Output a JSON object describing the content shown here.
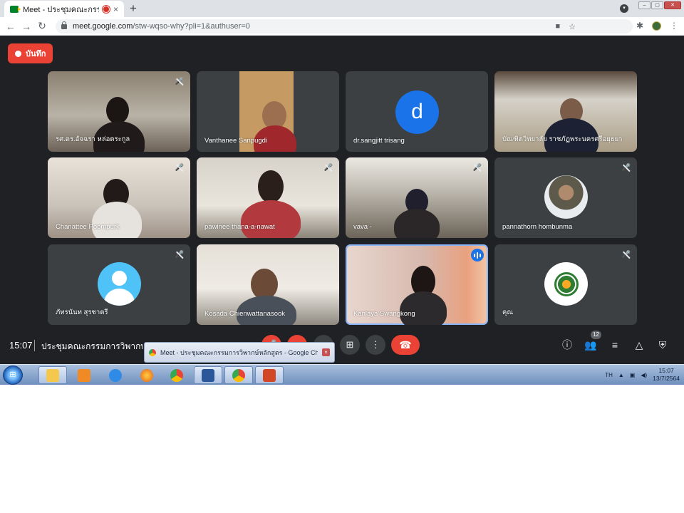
{
  "browser": {
    "tab_title": "Meet - ประชุมคณะกรรมการวิพากษ์",
    "tab_close": "×",
    "new_tab": "+",
    "url_host": "meet.google.com",
    "url_path": "/stw-wqso-why?pli=1&authuser=0",
    "back": "←",
    "forward": "→",
    "reload": "↻"
  },
  "meet": {
    "record_label": "บันทึก",
    "participants": [
      {
        "name": "รศ.ดร.อัจฉรา หล่อตระกูล",
        "muted": true
      },
      {
        "name": "Vanthanee Sanpugdi",
        "muted": false
      },
      {
        "name": "dr.sangjitt trisang",
        "muted": false,
        "initial": "d"
      },
      {
        "name": "บัณฑิตวิทยาลัย ราชภัฏพระนครศรีอยุธยา",
        "muted": false
      },
      {
        "name": "Chanattee Poompurk",
        "muted": true
      },
      {
        "name": "pawinee thana-a-nawat",
        "muted": true
      },
      {
        "name": "vava -",
        "muted": true
      },
      {
        "name": "pannathorn hombunma",
        "muted": true
      },
      {
        "name": "ภัทรนันท สุรชาตรี",
        "muted": true
      },
      {
        "name": "Kosada Chienwattanasook",
        "muted": false
      },
      {
        "name": "Kanlaya Swangkong",
        "muted": false,
        "speaking": true
      },
      {
        "name": "คุณ",
        "muted": true
      }
    ],
    "clock": "15:07",
    "meeting_title": "ประชุมคณะกรรมการวิพากษ์หลักสูตร",
    "people_count": "12",
    "icons": {
      "info": "ⓘ",
      "people": "👥",
      "chat": "≡",
      "activities": "△",
      "safety": "⛨",
      "present": "⊞",
      "more": "⋮",
      "end": "☎"
    }
  },
  "preview": {
    "text": "Meet - ประชุมคณะกรรมการวิพากษ์หลักสูตร - Google Chrome",
    "close": "×"
  },
  "taskbar": {
    "lang": "TH",
    "time": "15:07",
    "date": "13/7/2564"
  },
  "colors": {
    "meet_bg": "#202124",
    "tile_bg": "#3c4043",
    "record_red": "#ea4335",
    "active_blue": "#8ab4f8"
  }
}
